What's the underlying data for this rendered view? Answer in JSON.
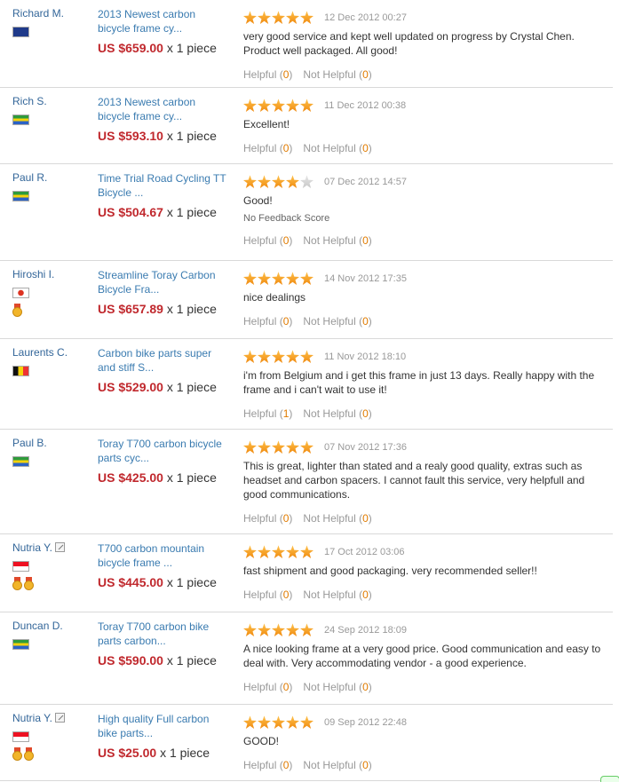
{
  "labels": {
    "helpful": "Helpful",
    "not_helpful": "Not Helpful",
    "qty_suffix": "x 1 piece"
  },
  "colors": {
    "price": "#c0282d",
    "link": "#3a7bb0",
    "star": "#f5a623",
    "count": "#e07b00"
  },
  "reviews": [
    {
      "buyer": "Richard M.",
      "flag": "australia",
      "product": "2013 Newest carbon bicycle frame cy...",
      "price": "US $659.00",
      "stars": 5,
      "date": "12 Dec 2012 00:27",
      "text": "very good service and kept well updated on progress by Crystal Chen. Product well packaged. All good!",
      "helpful": "0",
      "not_helpful": "0"
    },
    {
      "buyer": "Rich S.",
      "flag": "gabon",
      "product": "2013 Newest carbon bicycle frame cy...",
      "price": "US $593.10",
      "stars": 5,
      "date": "11 Dec 2012 00:38",
      "text": "Excellent!",
      "helpful": "0",
      "not_helpful": "0"
    },
    {
      "buyer": "Paul R.",
      "flag": "gabon",
      "product": "Time Trial Road Cycling TT Bicycle ...",
      "price": "US $504.67",
      "stars": 4,
      "date": "07 Dec 2012 14:57",
      "text": "Good!",
      "extra": "No Feedback Score",
      "helpful": "0",
      "not_helpful": "0"
    },
    {
      "buyer": "Hiroshi I.",
      "flag": "japan",
      "medals": 1,
      "product": "Streamline Toray Carbon Bicycle Fra...",
      "price": "US $657.89",
      "stars": 5,
      "date": "14 Nov 2012 17:35",
      "text": "nice dealings",
      "helpful": "0",
      "not_helpful": "0"
    },
    {
      "buyer": "Laurents C.",
      "flag": "belgium",
      "product": "Carbon bike parts super and stiff S...",
      "price": "US $529.00",
      "stars": 5,
      "date": "11 Nov 2012 18:10",
      "text": "i'm from Belgium and i get this frame in just 13 days. Really happy with the frame and i can't wait to use it!",
      "helpful": "1",
      "not_helpful": "0"
    },
    {
      "buyer": "Paul B.",
      "flag": "gabon",
      "product": "Toray T700 carbon bicycle parts cyc...",
      "price": "US $425.00",
      "stars": 5,
      "date": "07 Nov 2012 17:36",
      "text": "This is great, lighter than stated and a realy good quality, extras such as headset and carbon spacers. I cannot fault this service, very helpfull and good communications.",
      "helpful": "0",
      "not_helpful": "0"
    },
    {
      "buyer": "Nutria Y.",
      "flag": "indonesia",
      "edit": true,
      "medals": 2,
      "product": "T700 carbon mountain bicycle frame ...",
      "price": "US $445.00",
      "stars": 5,
      "date": "17 Oct 2012 03:06",
      "text": "fast shipment and good packaging. very recommended seller!!",
      "helpful": "0",
      "not_helpful": "0"
    },
    {
      "buyer": "Duncan D.",
      "flag": "gabon",
      "product": "Toray T700 carbon bike parts carbon...",
      "price": "US $590.00",
      "stars": 5,
      "date": "24 Sep 2012 18:09",
      "text": "A nice looking frame at a very good price. Good communication and easy to deal with. Very accommodating vendor - a good experience.",
      "helpful": "0",
      "not_helpful": "0"
    },
    {
      "buyer": "Nutria Y.",
      "flag": "indonesia",
      "edit": true,
      "medals": 2,
      "product": "High quality Full carbon bike parts...",
      "price": "US $25.00",
      "stars": 5,
      "date": "09 Sep 2012 22:48",
      "text": "GOOD!",
      "helpful": "0",
      "not_helpful": "0"
    }
  ]
}
